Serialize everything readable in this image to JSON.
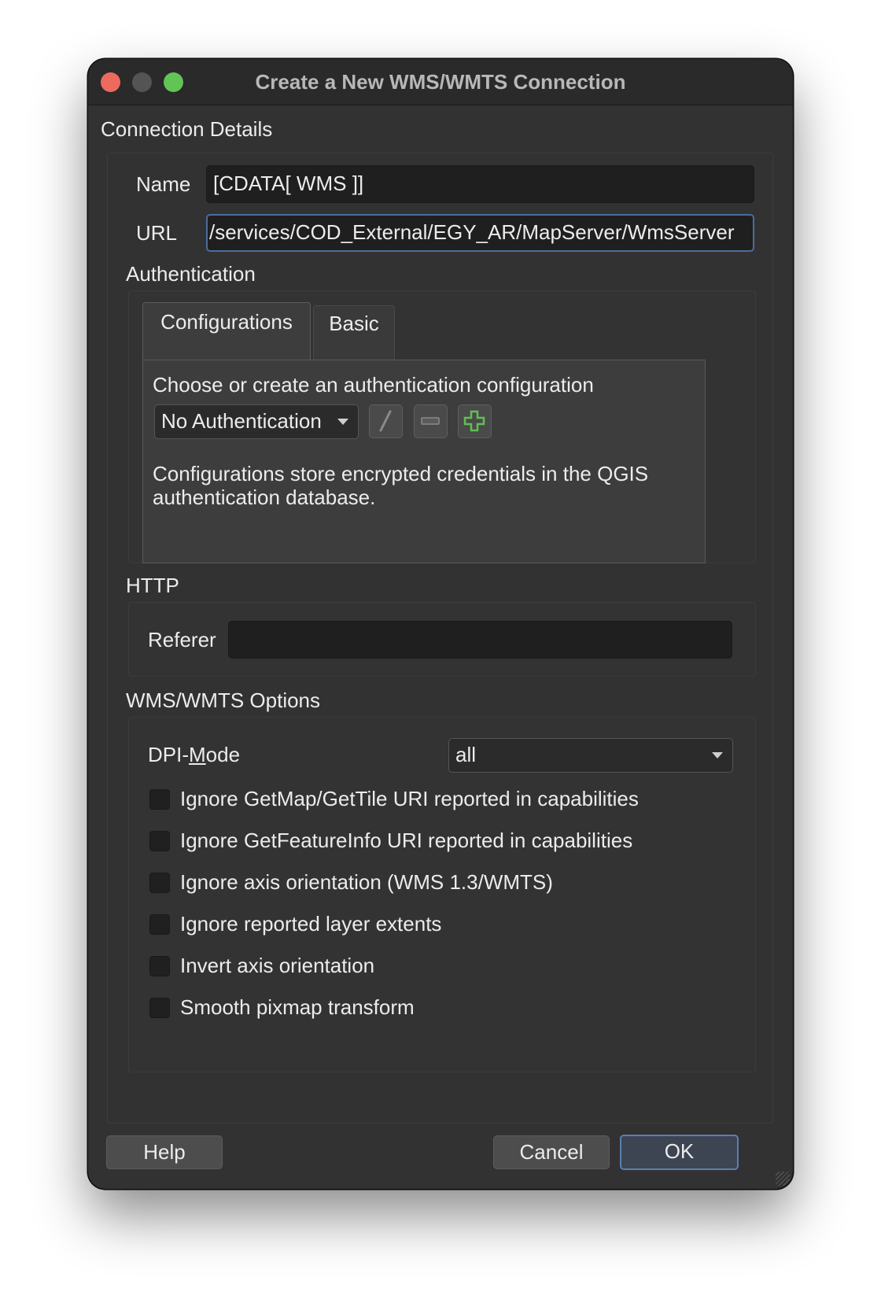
{
  "window": {
    "title": "Create a New WMS/WMTS Connection"
  },
  "connection": {
    "group_title": "Connection Details",
    "name_label": "Name",
    "name_value": "[CDATA[ WMS ]]",
    "url_label": "URL",
    "url_value": "/services/COD_External/EGY_AR/MapServer/WmsServer"
  },
  "authentication": {
    "group_title": "Authentication",
    "tabs": [
      {
        "label": "Configurations",
        "active": true
      },
      {
        "label": "Basic",
        "active": false
      }
    ],
    "prompt": "Choose or create an authentication configuration",
    "selected_config": "No Authentication",
    "description_line1": "Configurations store encrypted credentials in the QGIS",
    "description_line2": "authentication database."
  },
  "http": {
    "group_title": "HTTP",
    "referer_label": "Referer",
    "referer_value": ""
  },
  "options": {
    "group_title": "WMS/WMTS Options",
    "dpi_label_prefix": "DPI-",
    "dpi_label_mnemonic": "M",
    "dpi_label_suffix": "ode",
    "dpi_value": "all",
    "checkboxes": [
      {
        "label": "Ignore GetMap/GetTile URI reported in capabilities",
        "checked": false
      },
      {
        "label": "Ignore GetFeatureInfo URI reported in capabilities",
        "checked": false
      },
      {
        "label": "Ignore axis orientation (WMS 1.3/WMTS)",
        "checked": false
      },
      {
        "label": "Ignore reported layer extents",
        "checked": false
      },
      {
        "label": "Invert axis orientation",
        "checked": false
      },
      {
        "label": "Smooth pixmap transform",
        "checked": false
      }
    ]
  },
  "buttons": {
    "help": "Help",
    "cancel": "Cancel",
    "ok": "OK"
  },
  "colors": {
    "accent": "#5a7fb0",
    "close": "#ed6a5e",
    "maximize": "#61c454",
    "add_icon": "#5fc151"
  }
}
